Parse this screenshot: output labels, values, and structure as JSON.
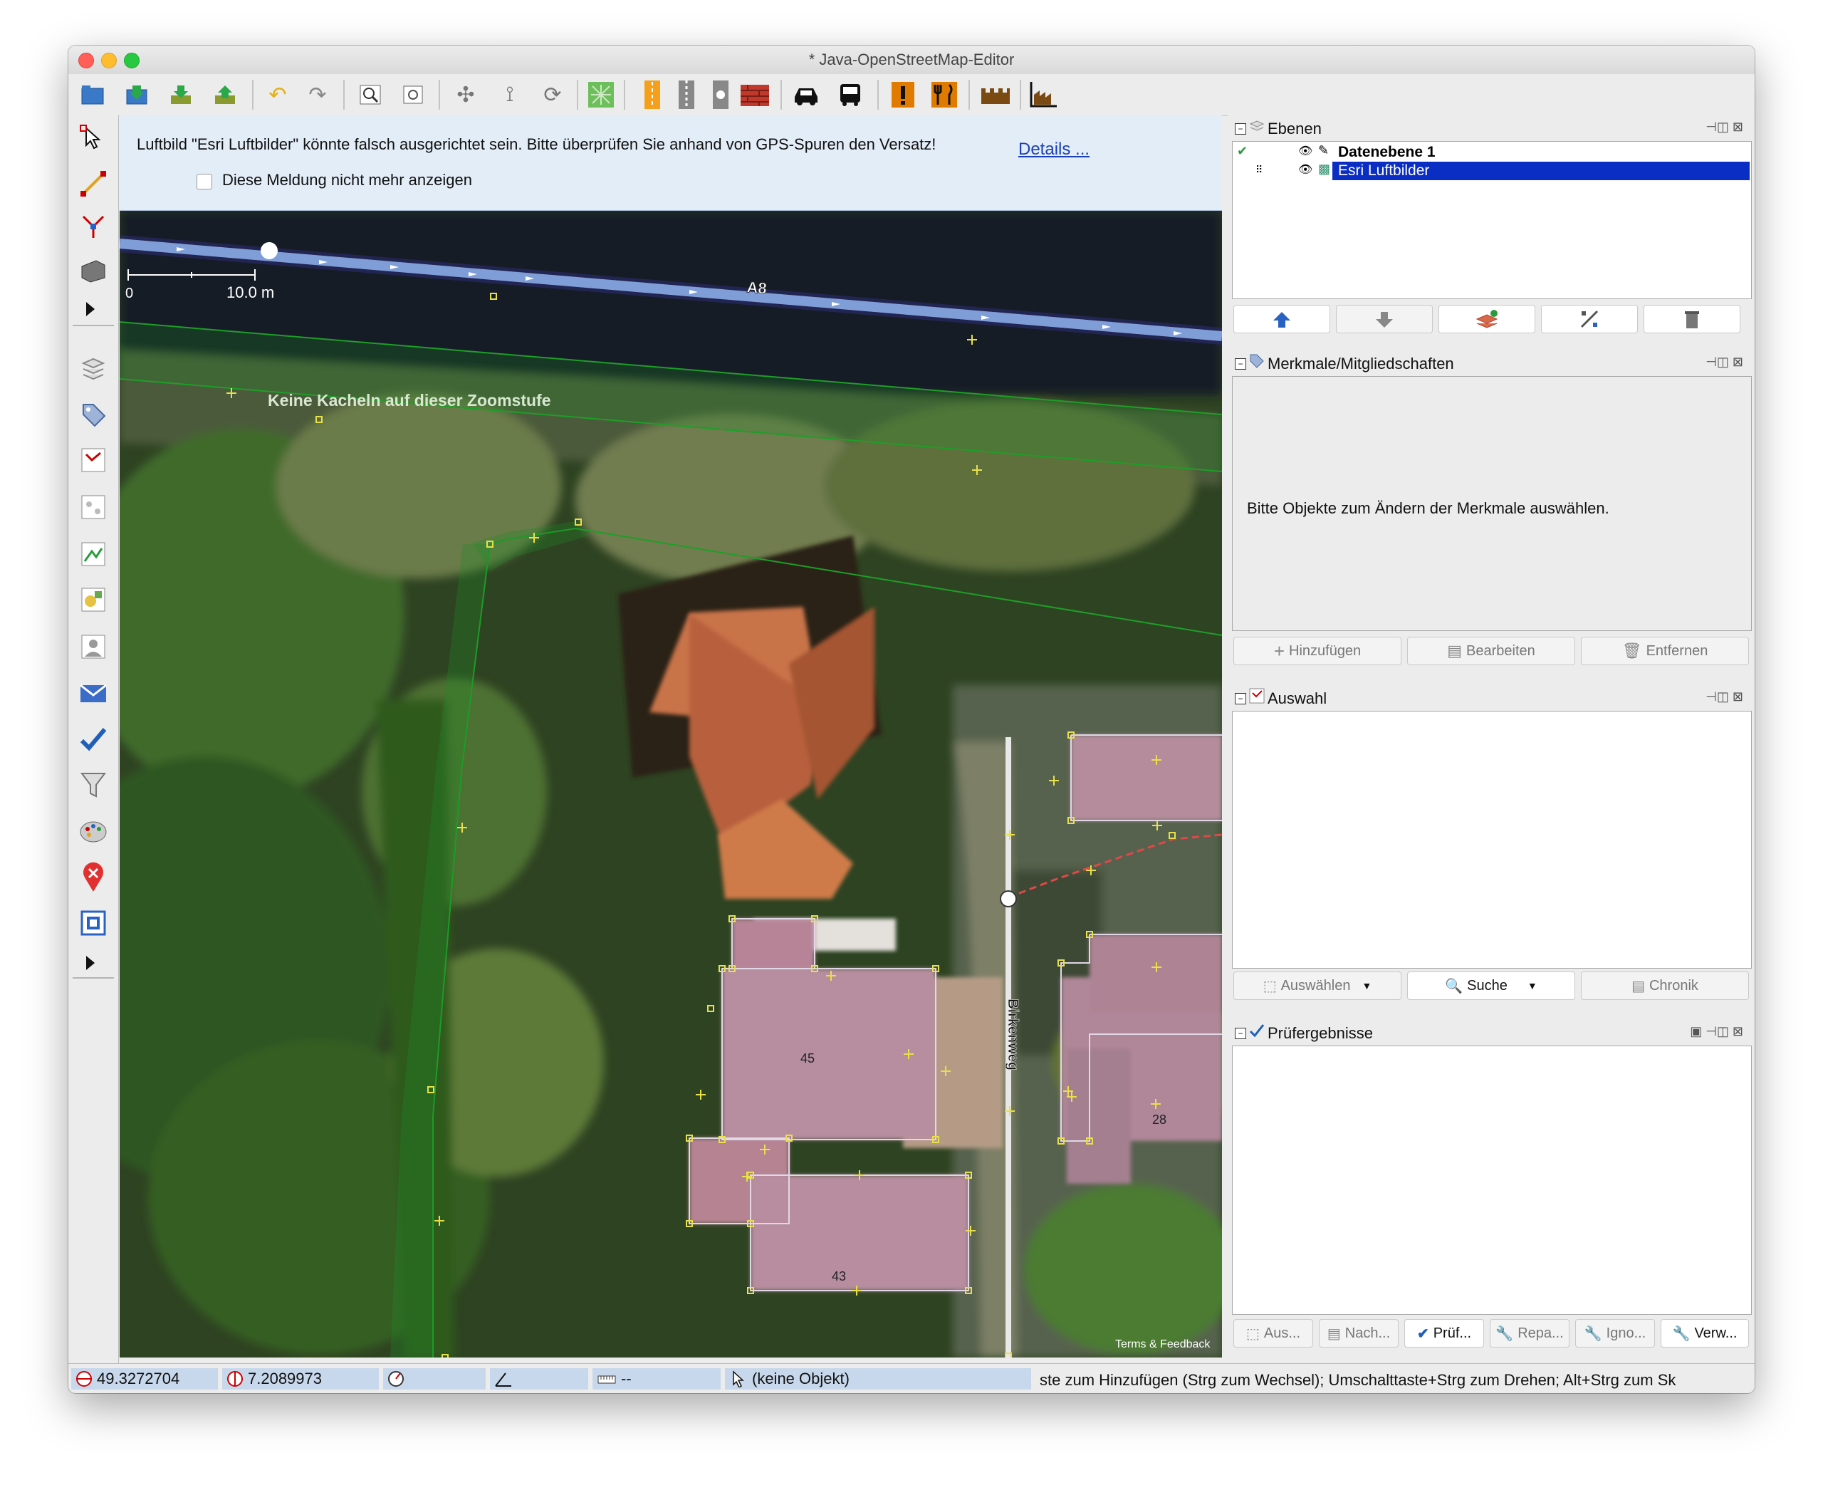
{
  "window": {
    "title": "* Java-OpenStreetMap-Editor"
  },
  "toolbar": {
    "icons": [
      "open-icon",
      "save-icon",
      "download-icon",
      "upload-icon",
      "undo-icon",
      "redo-icon",
      "zoom-icon",
      "preferences-icon",
      "simplify-icon",
      "split-icon",
      "refresh-icon",
      "wireframe-icon",
      "road-preset-icon",
      "rail-preset-icon",
      "traffic-light-icon",
      "wall-icon",
      "car-icon",
      "bus-icon",
      "warning-icon",
      "restaurant-icon",
      "castle-icon",
      "factory-icon"
    ]
  },
  "notification": {
    "text": "Luftbild \"Esri Luftbilder\" könnte falsch ausgerichtet sein. Bitte überprüfen Sie anhand von GPS-Spuren den Versatz!",
    "details_link": "Details ...",
    "close": "✕",
    "checkbox_label": "Diese Meldung nicht mehr anzeigen"
  },
  "map": {
    "scale_start": "0",
    "scale_label": "10.0 m",
    "motorway_label": "A8",
    "no_tiles_message": "Keine Kacheln auf dieser Zoomstufe",
    "street_label": "Birkenweg",
    "house_numbers": [
      "45",
      "43",
      "28"
    ],
    "attribution": "Terms & Feedback"
  },
  "panels": {
    "layers": {
      "title": "Ebenen",
      "items": [
        {
          "name": "Datenebene 1",
          "selected": false
        },
        {
          "name": "Esri Luftbilder",
          "selected": true
        }
      ]
    },
    "tags": {
      "title": "Merkmale/Mitgliedschaften",
      "empty_message": "Bitte Objekte zum Ändern der Merkmale auswählen.",
      "buttons": {
        "add": "Hinzufügen",
        "edit": "Bearbeiten",
        "remove": "Entfernen"
      }
    },
    "selection": {
      "title": "Auswahl",
      "buttons": {
        "select": "Auswählen",
        "search": "Suche",
        "history": "Chronik"
      }
    },
    "validation": {
      "title": "Prüfergebnisse",
      "buttons": {
        "select": "Aus...",
        "zoom": "Nach...",
        "validate": "Prüf...",
        "fix": "Repa...",
        "ignore": "Igno...",
        "manage": "Verw..."
      }
    }
  },
  "status": {
    "lat": "49.3272704",
    "lon": "7.2089973",
    "distance": "--",
    "selection": "(keine Objekt)",
    "help": "ste zum Hinzufügen (Strg zum Wechsel); Umschalttaste+Strg zum Drehen; Alt+Strg zum Sk"
  },
  "colors": {
    "selection_blue": "#0a2ec4",
    "motorway": "#7f9ed8",
    "boundary_green": "#1e9e28",
    "node_yellow": "#e8e04a",
    "building_pink": "#c48fa8",
    "status_blue": "#c8d8ec"
  }
}
